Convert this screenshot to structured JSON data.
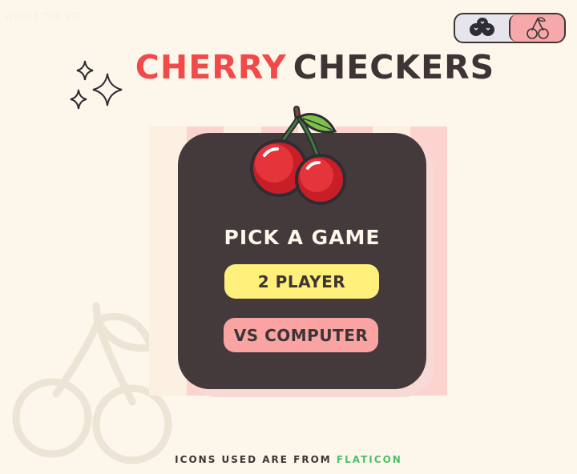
{
  "corner_text": "WHOLE THE STE",
  "title": {
    "part1": "CHERRY",
    "part2": "CHECKERS"
  },
  "theme_toggle": {
    "options": [
      "blueberry-theme",
      "cherry-theme"
    ],
    "active": "cherry-theme"
  },
  "menu": {
    "heading": "PICK A GAME",
    "two_player": "2 PLAYER",
    "vs_computer": "VS COMPUTER"
  },
  "footer": {
    "prefix": "ICONS USED ARE FROM",
    "link": "FLATICON"
  },
  "colors": {
    "background": "#fdf6ea",
    "title_accent": "#f24a4a",
    "dark": "#3e3435",
    "card": "#453a3b",
    "yellow_button": "#fef07a",
    "pink_button": "#f9a3a3",
    "link": "#4cc06a"
  }
}
